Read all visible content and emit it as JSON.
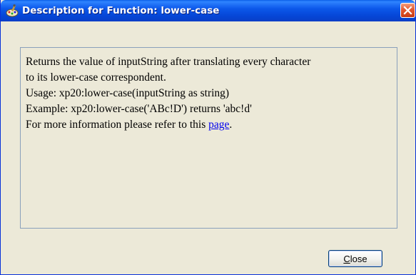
{
  "window": {
    "title": "Description for Function: lower-case",
    "title_icon": "function-wizard-icon",
    "close_icon": "close-x-icon"
  },
  "description": {
    "line1": "Returns the value of inputString after translating every character",
    "line2": "to its lower-case correspondent.",
    "line3": "Usage: xp20:lower-case(inputString as string)",
    "line4": "Example: xp20:lower-case('ABc!D') returns 'abc!d'",
    "line5_prefix": "For more information please refer to this ",
    "link_text": "page",
    "line5_suffix": "."
  },
  "buttons": {
    "close_mnemonic": "C",
    "close_rest": "lose"
  },
  "colors": {
    "title_bar": "#0a55e0",
    "window_bg": "#ece9d8",
    "link": "#0000ee",
    "close_button": "#e3582f"
  }
}
